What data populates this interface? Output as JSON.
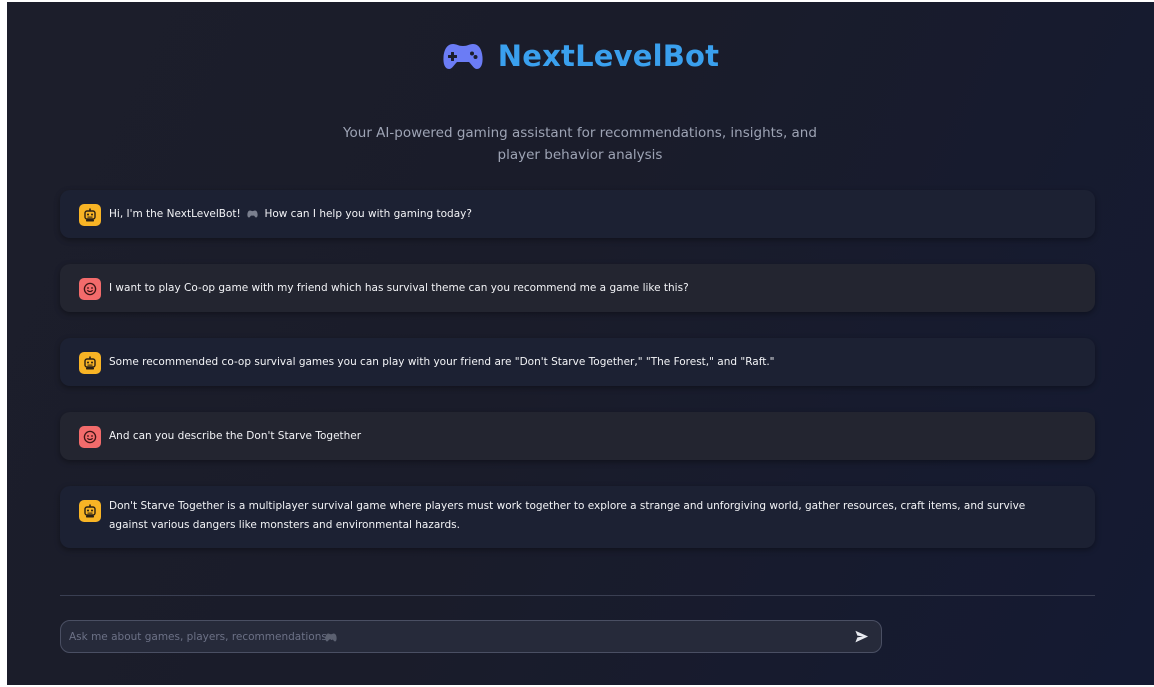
{
  "header": {
    "title": "NextLevelBot",
    "logo_icon": "gamepad-icon",
    "subtitle": "Your AI-powered gaming assistant for recommendations, insights, and player behavior analysis"
  },
  "messages": [
    {
      "role": "bot",
      "avatar_icon": "robot-icon",
      "text_before": "Hi, I'm the NextLevelBot!",
      "inline_icon": "gamepad-icon",
      "text_after": "How can I help you with gaming today?"
    },
    {
      "role": "user",
      "avatar_icon": "smiley-icon",
      "text": "I want to play Co-op game with my friend which has survival theme can you recommend me a game like this?"
    },
    {
      "role": "bot",
      "avatar_icon": "robot-icon",
      "text": "Some recommended co-op survival games you can play with your friend are \"Don't Starve Together,\" \"The Forest,\" and \"Raft.\""
    },
    {
      "role": "user",
      "avatar_icon": "smiley-icon",
      "text": "And can you describe the Don't Starve Together"
    },
    {
      "role": "bot",
      "avatar_icon": "robot-icon",
      "text": "Don't Starve Together is a multiplayer survival game where players must work together to explore a strange and unforgiving world, gather resources, craft items, and survive against various dangers like monsters and environmental hazards."
    }
  ],
  "input": {
    "placeholder": "Ask me about games, players, recommendations...",
    "placeholder_icon": "gamepad-icon",
    "send_icon": "send-icon"
  },
  "colors": {
    "brand": "#3aa0ee",
    "logo": "#6b7cf5",
    "bot_avatar": "#f8b425",
    "user_avatar": "#f26b6b",
    "bot_bubble": "#1c2133",
    "user_bubble": "#232530"
  }
}
